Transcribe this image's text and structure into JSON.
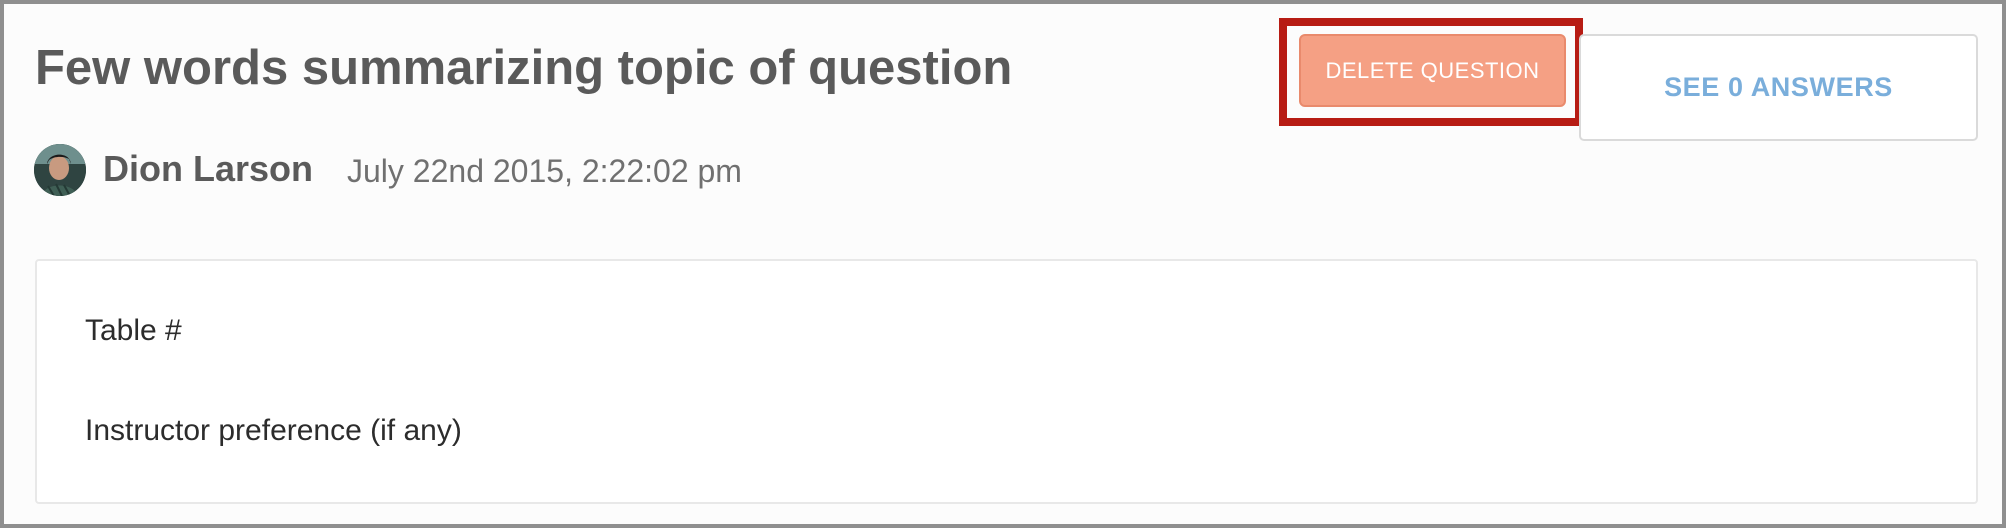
{
  "question": {
    "title": "Few words summarizing topic of question",
    "author": "Dion Larson",
    "timestamp": "July 22nd 2015, 2:22:02 pm",
    "body_lines": [
      "Table #",
      "Instructor preference (if any)"
    ]
  },
  "actions": {
    "delete_label": "DELETE QUESTION",
    "answers_label": "SEE 0 ANSWERS"
  },
  "colors": {
    "delete_button": "#f5a084",
    "highlight_border": "#b71c14",
    "answers_text": "#7aaedb",
    "title_text": "#5a5a5a"
  },
  "icons": {
    "avatar": "user-avatar"
  }
}
